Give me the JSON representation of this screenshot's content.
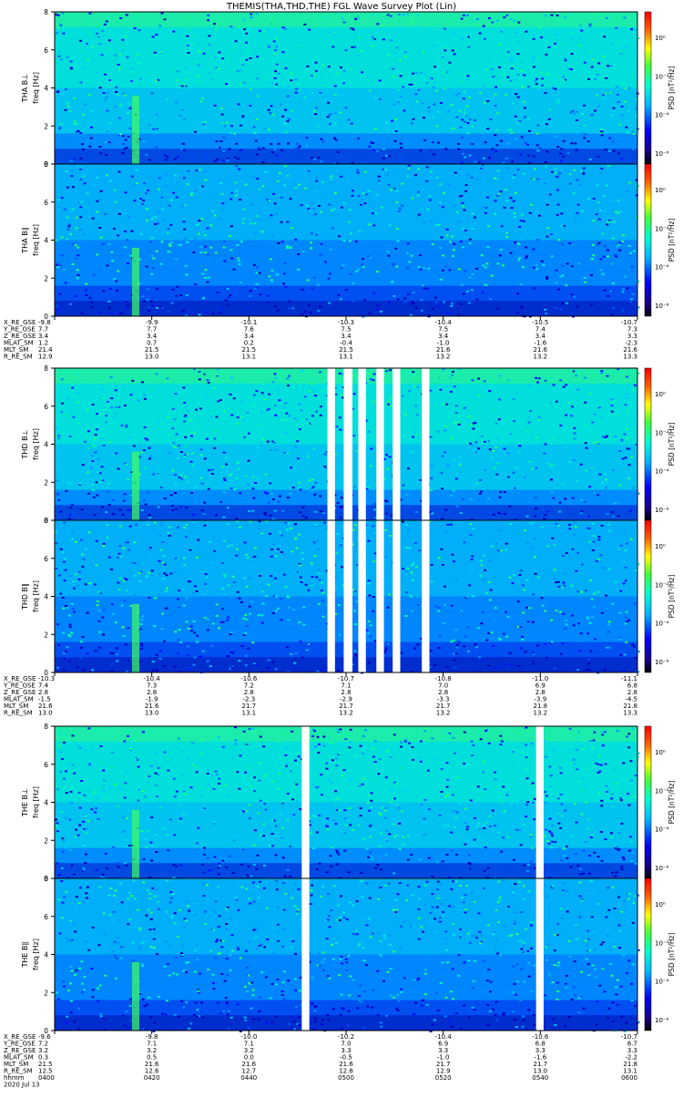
{
  "title": "THEMIS(THA,THD,THE) FGL Wave Survey Plot (Lin)",
  "date_label": "2020 Jul 13",
  "colorbar_label": "PSD [nT²/Hz]",
  "colorbar_ticks": [
    "10⁰",
    "10⁻²",
    "10⁻⁴",
    "10⁻⁶"
  ],
  "freq_ticks": [
    "0",
    "2",
    "4",
    "6",
    "8"
  ],
  "groups": [
    {
      "id": "tha",
      "panels": [
        {
          "label": "THA B⊥",
          "ylabel": "freq [Hz]"
        },
        {
          "label": "THA B∥",
          "ylabel": "freq [Hz]"
        }
      ],
      "ephem_labels": [
        "X_RE_GSE",
        "Y_RE_GSE",
        "Z_RE_GSE",
        "MLAT_SM",
        "MLT_SM",
        "R_RE_SM"
      ],
      "ephem_values": [
        [
          "-9.8",
          "-9.9",
          "-10.1",
          "-10.3",
          "-10.4",
          "-10.5",
          "-10.7"
        ],
        [
          "7.7",
          "7.7",
          "7.6",
          "7.5",
          "7.5",
          "7.4",
          "7.3"
        ],
        [
          "3.4",
          "3.4",
          "3.4",
          "3.4",
          "3.4",
          "3.4",
          "3.3"
        ],
        [
          "1.2",
          "0.7",
          "0.2",
          "-0.4",
          "-1.0",
          "-1.6",
          "-2.3"
        ],
        [
          "21.4",
          "21.5",
          "21.5",
          "21.5",
          "21.6",
          "21.6",
          "21.6"
        ],
        [
          "12.9",
          "13.0",
          "13.1",
          "13.1",
          "13.2",
          "13.2",
          "13.3"
        ]
      ]
    },
    {
      "id": "thd",
      "panels": [
        {
          "label": "THD B⊥",
          "ylabel": "freq [Hz]"
        },
        {
          "label": "THD B∥",
          "ylabel": "freq [Hz]"
        }
      ],
      "ephem_labels": [
        "X_RE_GSE",
        "Y_RE_GSE",
        "Z_RE_GSE",
        "MLAT_SM",
        "MLT_SM",
        "R_RE_SM"
      ],
      "ephem_values": [
        [
          "-10.3",
          "-10.4",
          "-10.6",
          "-10.7",
          "-10.8",
          "-11.0",
          "-11.1"
        ],
        [
          "7.4",
          "7.3",
          "7.2",
          "7.1",
          "7.0",
          "6.9",
          "6.8"
        ],
        [
          "2.8",
          "2.8",
          "2.8",
          "2.8",
          "2.8",
          "2.8",
          "2.8"
        ],
        [
          "-1.5",
          "-1.9",
          "-2.3",
          "-2.9",
          "-3.3",
          "-3.9",
          "-4.5"
        ],
        [
          "21.6",
          "21.6",
          "21.7",
          "21.7",
          "21.7",
          "21.8",
          "21.8"
        ],
        [
          "13.0",
          "13.0",
          "13.1",
          "13.2",
          "13.2",
          "13.2",
          "13.3"
        ]
      ],
      "gaps": [
        [
          0.468,
          0.481
        ],
        [
          0.496,
          0.511
        ],
        [
          0.521,
          0.534
        ],
        [
          0.552,
          0.565
        ],
        [
          0.58,
          0.593
        ],
        [
          0.63,
          0.643
        ]
      ]
    },
    {
      "id": "the",
      "panels": [
        {
          "label": "THE B⊥",
          "ylabel": "freq [Hz]"
        },
        {
          "label": "THE B∥",
          "ylabel": "freq [Hz]"
        }
      ],
      "ephem_labels": [
        "X_RE_GSE",
        "Y_RE_GSE",
        "Z_RE_GSE",
        "MLAT_SM",
        "MLT_SM",
        "R_RE_SM",
        "hhmm"
      ],
      "ephem_values": [
        [
          "-9.6",
          "-9.8",
          "-10.0",
          "-10.2",
          "-10.4",
          "-10.6",
          "-10.7"
        ],
        [
          "7.2",
          "7.1",
          "7.1",
          "7.0",
          "6.9",
          "6.8",
          "6.7"
        ],
        [
          "3.2",
          "3.2",
          "3.2",
          "3.3",
          "3.3",
          "3.3",
          "3.3"
        ],
        [
          "0.3",
          "0.5",
          "0.0",
          "-0.5",
          "-1.0",
          "-1.6",
          "-2.2"
        ],
        [
          "21.5",
          "21.6",
          "21.6",
          "21.6",
          "21.7",
          "21.7",
          "21.8"
        ],
        [
          "12.5",
          "12.6",
          "12.7",
          "12.8",
          "12.9",
          "13.0",
          "13.1"
        ],
        [
          "0400",
          "0420",
          "0440",
          "0500",
          "0520",
          "0540",
          "0600"
        ]
      ],
      "gaps": [
        [
          0.424,
          0.437
        ],
        [
          0.826,
          0.839
        ]
      ]
    }
  ],
  "chart_data": {
    "type": "heatmap",
    "title": "THEMIS(THA,THD,THE) FGL Wave Survey Plot (Lin)",
    "x_time_ticks": [
      "0400",
      "0420",
      "0440",
      "0500",
      "0520",
      "0540",
      "0600"
    ],
    "date": "2020 Jul 13",
    "ylim": [
      0,
      8
    ],
    "ylabel": "freq [Hz]",
    "color_scale": "log",
    "color_range": [
      1e-06,
      10.0
    ],
    "colorbar_label": "PSD [nT²/Hz]",
    "panels": [
      "THA B⊥",
      "THA B∥",
      "THD B⊥",
      "THD B∥",
      "THE B⊥",
      "THE B∥"
    ]
  }
}
